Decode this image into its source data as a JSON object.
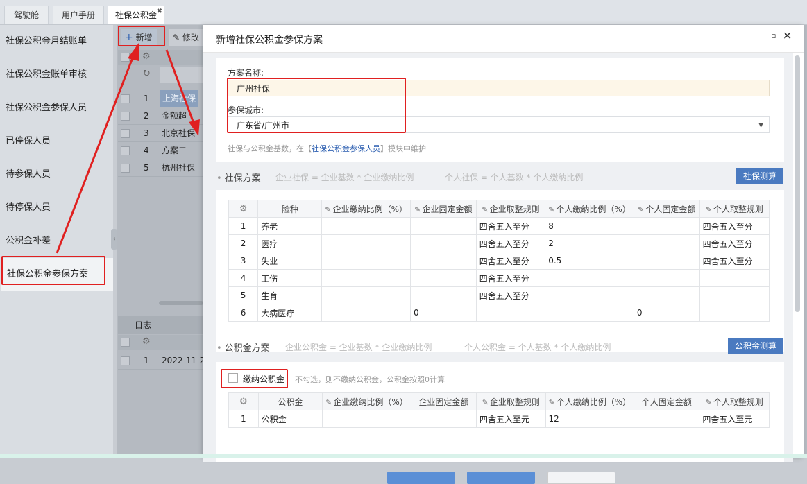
{
  "tabs": [
    "驾驶舱",
    "用户手册",
    "社保公积金"
  ],
  "sidebar": {
    "items": [
      "社保公积金月结账单",
      "社保公积金账单审核",
      "社保公积金参保人员",
      "已停保人员",
      "待参保人员",
      "待停保人员",
      "公积金补差",
      "社保公积金参保方案"
    ]
  },
  "bg": {
    "add_label": "新增",
    "edit_label": "修改",
    "rows": [
      {
        "num": "1",
        "text": "上海社保"
      },
      {
        "num": "2",
        "text": "金额超"
      },
      {
        "num": "3",
        "text": "北京社保"
      },
      {
        "num": "4",
        "text": "方案二"
      },
      {
        "num": "5",
        "text": "杭州社保"
      }
    ],
    "log_tab": "日志",
    "log_row": {
      "num": "1",
      "text": "2022-11-2"
    }
  },
  "modal": {
    "title": "新增社保公积金参保方案",
    "name_label": "方案名称:",
    "name_value": "广州社保",
    "city_label": "参保城市:",
    "city_value": "广东省/广州市",
    "hint_pre": "社保与公积金基数，在【",
    "hint_link": "社保公积金参保人员",
    "hint_post": "】模块中维护",
    "social": {
      "title": "社保方案",
      "formula1": "企业社保 = 企业基数 * 企业缴纳比例",
      "formula2": "个人社保 = 个人基数 * 个人缴纳比例",
      "calc_btn": "社保测算",
      "headers": [
        "险种",
        "企业缴纳比例（%）",
        "企业固定金额",
        "企业取整规则",
        "个人缴纳比例（%）",
        "个人固定金额",
        "个人取整规则"
      ],
      "rows": [
        [
          "1",
          "养老",
          "",
          "",
          "四舍五入至分",
          "8",
          "",
          "四舍五入至分"
        ],
        [
          "2",
          "医疗",
          "",
          "",
          "四舍五入至分",
          "2",
          "",
          "四舍五入至分"
        ],
        [
          "3",
          "失业",
          "",
          "",
          "四舍五入至分",
          "0.5",
          "",
          "四舍五入至分"
        ],
        [
          "4",
          "工伤",
          "",
          "",
          "四舍五入至分",
          "",
          "",
          ""
        ],
        [
          "5",
          "生育",
          "",
          "",
          "四舍五入至分",
          "",
          "",
          ""
        ],
        [
          "6",
          "大病医疗",
          "",
          "0",
          "",
          "",
          "0",
          ""
        ]
      ]
    },
    "fund": {
      "title": "公积金方案",
      "formula1": "企业公积金 = 企业基数 * 企业缴纳比例",
      "formula2": "个人公积金 = 个人基数 * 个人缴纳比例",
      "calc_btn": "公积金测算",
      "checkbox_label": "缴纳公积金",
      "checkbox_hint": "不勾选，则不缴纳公积金，公积金按照0计算",
      "headers": [
        "公积金",
        "企业缴纳比例（%）",
        "企业固定金额",
        "企业取整规则",
        "个人缴纳比例（%）",
        "个人固定金额",
        "个人取整规则"
      ],
      "rows": [
        [
          "1",
          "公积金",
          "",
          "",
          "四舍五入至元",
          "12",
          "",
          "四舍五入至元"
        ]
      ]
    }
  },
  "colors": {
    "accent": "#4a7ac0",
    "annotation": "#e02020",
    "input_bg": "#fdf6e8"
  }
}
